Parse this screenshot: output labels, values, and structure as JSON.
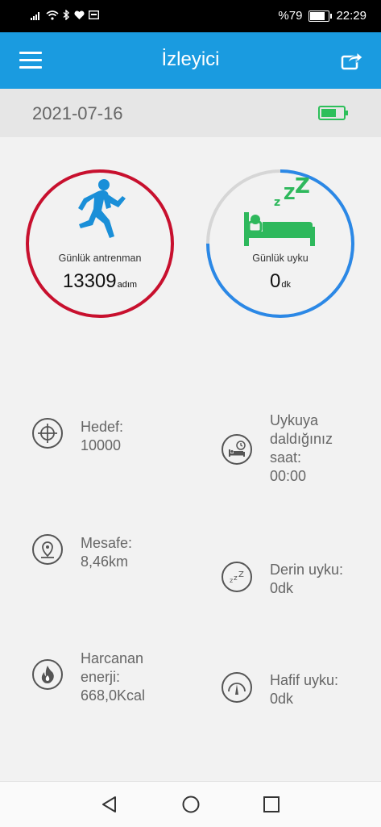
{
  "status_bar": {
    "battery_percent": "%79",
    "time": "22:29",
    "battery_level": 0.79
  },
  "app_bar": {
    "title": "İzleyici",
    "menu_icon": "hamburger-menu-icon",
    "share_icon": "share-icon",
    "color": "#1a9be0"
  },
  "date_bar": {
    "date": "2021-07-16",
    "device_battery_icon": "battery-icon",
    "device_battery_color": "#2dbf5a"
  },
  "activity_ring": {
    "label": "Günlük antrenman",
    "value": "13309",
    "unit": "adım",
    "progress": 1.0,
    "color": "#c8102e",
    "icon": "running-person-icon"
  },
  "sleep_ring": {
    "label": "Günlük uyku",
    "value": "0",
    "unit": "dk",
    "progress": 0.75,
    "color": "#2b88e6",
    "track_color": "#d6d6d6",
    "icon": "sleeping-bed-icon"
  },
  "stats_left": [
    {
      "label": "Hedef:",
      "value": "10000",
      "icon": "target-icon"
    },
    {
      "label": "Mesafe:",
      "value": "8,46km",
      "icon": "location-pin-icon"
    },
    {
      "label": "Harcanan enerji:",
      "value": "668,0Kcal",
      "icon": "flame-icon"
    }
  ],
  "stats_right": [
    {
      "label": "Uykuya daldığınız saat:",
      "value": "00:00",
      "icon": "bed-clock-icon"
    },
    {
      "label": "Derin uyku:",
      "value": "0dk",
      "icon": "zzz-icon"
    },
    {
      "label": "Hafif uyku:",
      "value": "0dk",
      "icon": "gauge-icon"
    }
  ],
  "nav_bar": {
    "back_icon": "back-triangle-icon",
    "home_icon": "home-circle-icon",
    "recents_icon": "recents-square-icon"
  }
}
